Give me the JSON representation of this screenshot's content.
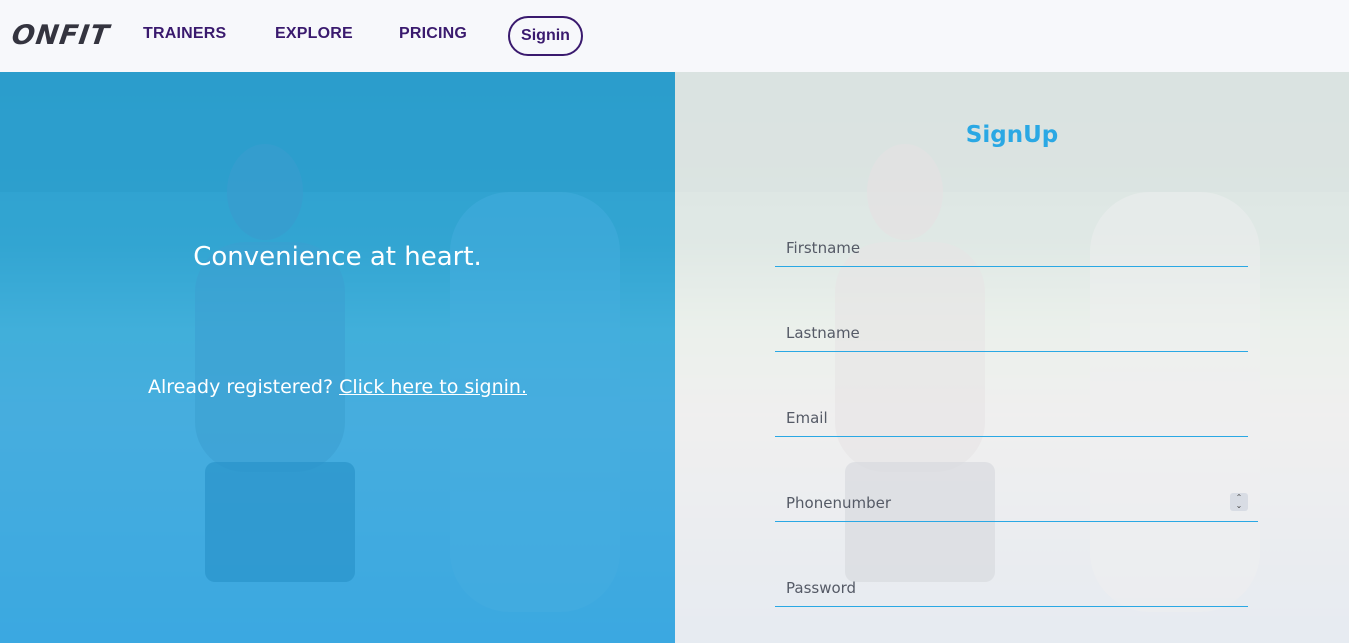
{
  "brand": {
    "logo": "ONFIT"
  },
  "nav": {
    "trainers": "TRAINERS",
    "explore": "EXPLORE",
    "pricing": "PRICING",
    "signin": "Signin"
  },
  "left": {
    "tagline": "Convenience at heart.",
    "prompt_text": "Already registered? ",
    "prompt_link": "Click here to signin."
  },
  "form": {
    "title": "SignUp",
    "fields": {
      "firstname": "Firstname",
      "lastname": "Lastname",
      "email": "Email",
      "phone": "Phonenumber",
      "password": "Password"
    }
  },
  "colors": {
    "accent": "#2aa8e4",
    "nav_text": "#3a1a6e",
    "left_overlay": "#29abec"
  }
}
